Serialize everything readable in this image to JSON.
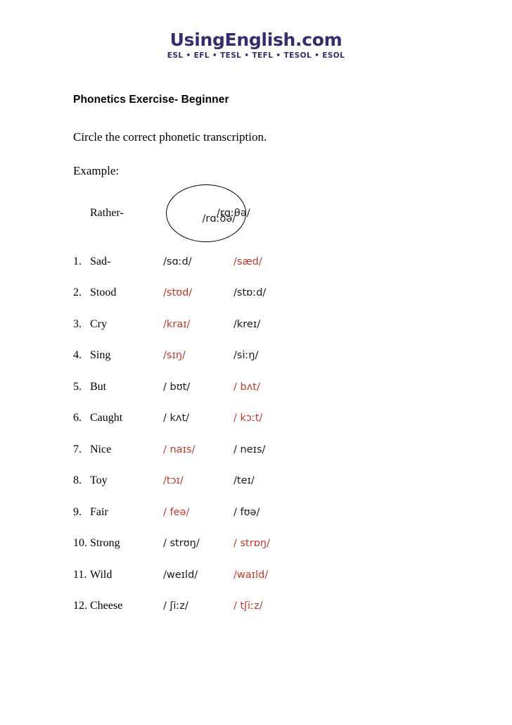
{
  "site_logo": {
    "wordmark": "UsingEnglish.com",
    "tagline": "ESL • EFL • TESL • TEFL • TESOL • ESOL",
    "brand_color": "#342d6e"
  },
  "document": {
    "title": "Phonetics Exercise- Beginner",
    "instruction": "Circle the correct phonetic transcription.",
    "example_label": "Example:",
    "answer_color": "#c0392b"
  },
  "example": {
    "number": "",
    "word": "Rather-",
    "option_a": "/rɑːðə/",
    "option_b": "/rɑːθə/",
    "circled": "a"
  },
  "items": [
    {
      "number": "1.",
      "word": "Sad-",
      "option_a": "/sɑːd/",
      "option_b": "/sæd/",
      "correct": "b"
    },
    {
      "number": "2.",
      "word": "Stood",
      "option_a": "/stʊd/",
      "option_b": "/stɒːd/",
      "correct": "a"
    },
    {
      "number": "3.",
      "word": "Cry",
      "option_a": "/kraɪ/",
      "option_b": "/kreɪ/",
      "correct": "a"
    },
    {
      "number": "4.",
      "word": "Sing",
      "option_a": "/sɪŋ/",
      "option_b": "/siːŋ/",
      "correct": "a"
    },
    {
      "number": "5.",
      "word": "But",
      "option_a": "/ bʊt/",
      "option_b": "/ bʌt/",
      "correct": "b"
    },
    {
      "number": "6.",
      "word": "Caught",
      "option_a": "/ kʌt/",
      "option_b": "/ kɔːt/",
      "correct": "b"
    },
    {
      "number": "7.",
      "word": "Nice",
      "option_a": "/ naɪs/",
      "option_b": "/ neɪs/",
      "correct": "a"
    },
    {
      "number": "8.",
      "word": "Toy",
      "option_a": "/tɔɪ/",
      "option_b": "/teɪ/",
      "correct": "a"
    },
    {
      "number": "9.",
      "word": "Fair",
      "option_a": "/ feə/",
      "option_b": "/ fʊə/",
      "correct": "a"
    },
    {
      "number": "10.",
      "word": "Strong",
      "option_a": "/ strʊŋ/",
      "option_b": "/ strɒŋ/",
      "correct": "b"
    },
    {
      "number": "11.",
      "word": "Wild",
      "option_a": "/weɪld/",
      "option_b": "/waɪld/",
      "correct": "b"
    },
    {
      "number": "12.",
      "word": "Cheese",
      "option_a": "/ ʃiːz/",
      "option_b": "/ tʃiːz/",
      "correct": "b"
    }
  ]
}
